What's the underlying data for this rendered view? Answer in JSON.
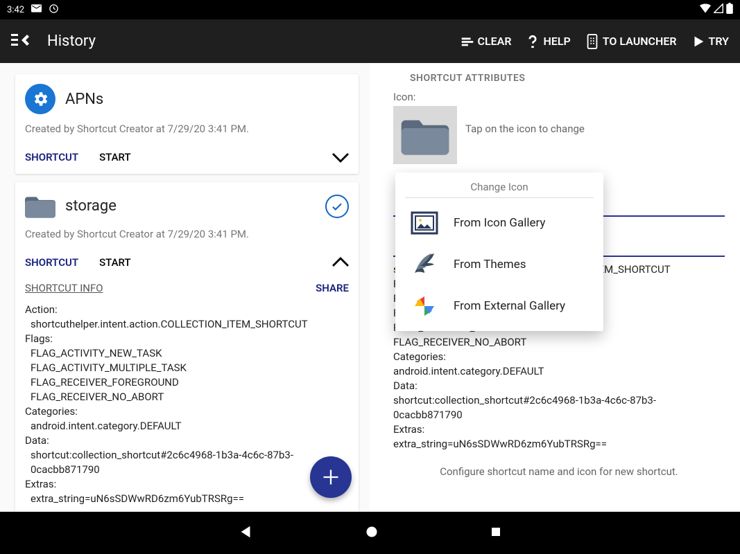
{
  "status": {
    "time": "3:42"
  },
  "appbar": {
    "title": "History",
    "clear": "CLEAR",
    "help": "HELP",
    "launcher": "TO LAUNCHER",
    "try": "TRY"
  },
  "cards": [
    {
      "title": "APNs",
      "subtitle": "Created by Shortcut Creator at 7/29/20 3:41 PM.",
      "shortcut": "SHORTCUT",
      "start": "START"
    },
    {
      "title": "storage",
      "subtitle": "Created by Shortcut Creator at 7/29/20 3:41 PM.",
      "shortcut": "SHORTCUT",
      "start": "START",
      "info": "SHORTCUT INFO",
      "share": "SHARE",
      "action_k": "Action:",
      "action_v": "shortcuthelper.intent.action.COLLECTION_ITEM_SHORTCUT",
      "flags_k": "Flags:",
      "flags_v1": "FLAG_ACTIVITY_NEW_TASK",
      "flags_v2": "FLAG_ACTIVITY_MULTIPLE_TASK",
      "flags_v3": "FLAG_RECEIVER_FOREGROUND",
      "flags_v4": "FLAG_RECEIVER_NO_ABORT",
      "cat_k": "Categories:",
      "cat_v": "android.intent.category.DEFAULT",
      "data_k": "Data:",
      "data_v": "shortcut:collection_shortcut#2c6c4968-1b3a-4c6c-87b3-0cacbb871790",
      "extras_k": "Extras:",
      "extras_v": "extra_string=uN6sSDWwRD6zm6YubTRSRg=="
    }
  ],
  "right": {
    "header": "SHORTCUT ATTRIBUTES",
    "icon_label": "Icon:",
    "icon_hint": "Tap on the icon to change",
    "action_v": "shortcuthelper.intent.action.COLLECTION_ITEM_SHORTCUT",
    "flags_k": "Flags:",
    "flags_v1": "FLAG_ACTIVITY_NEW_TASK",
    "flags_v2": "FLAG_ACTIVITY_MULTIPLE_TASK",
    "flags_v3": "FLAG_RECEIVER_FOREGROUND",
    "flags_v4": "FLAG_RECEIVER_NO_ABORT",
    "cat_k": "Categories:",
    "cat_v": "android.intent.category.DEFAULT",
    "data_k": "Data:",
    "data_v": "shortcut:collection_shortcut#2c6c4968-1b3a-4c6c-87b3-0cacbb871790",
    "extras_k": "Extras:",
    "extras_v": "extra_string=uN6sSDWwRD6zm6YubTRSRg==",
    "footer": "Configure shortcut name and icon for new shortcut."
  },
  "popup": {
    "title": "Change Icon",
    "item1": "From Icon Gallery",
    "item2": "From Themes",
    "item3": "From External Gallery"
  }
}
